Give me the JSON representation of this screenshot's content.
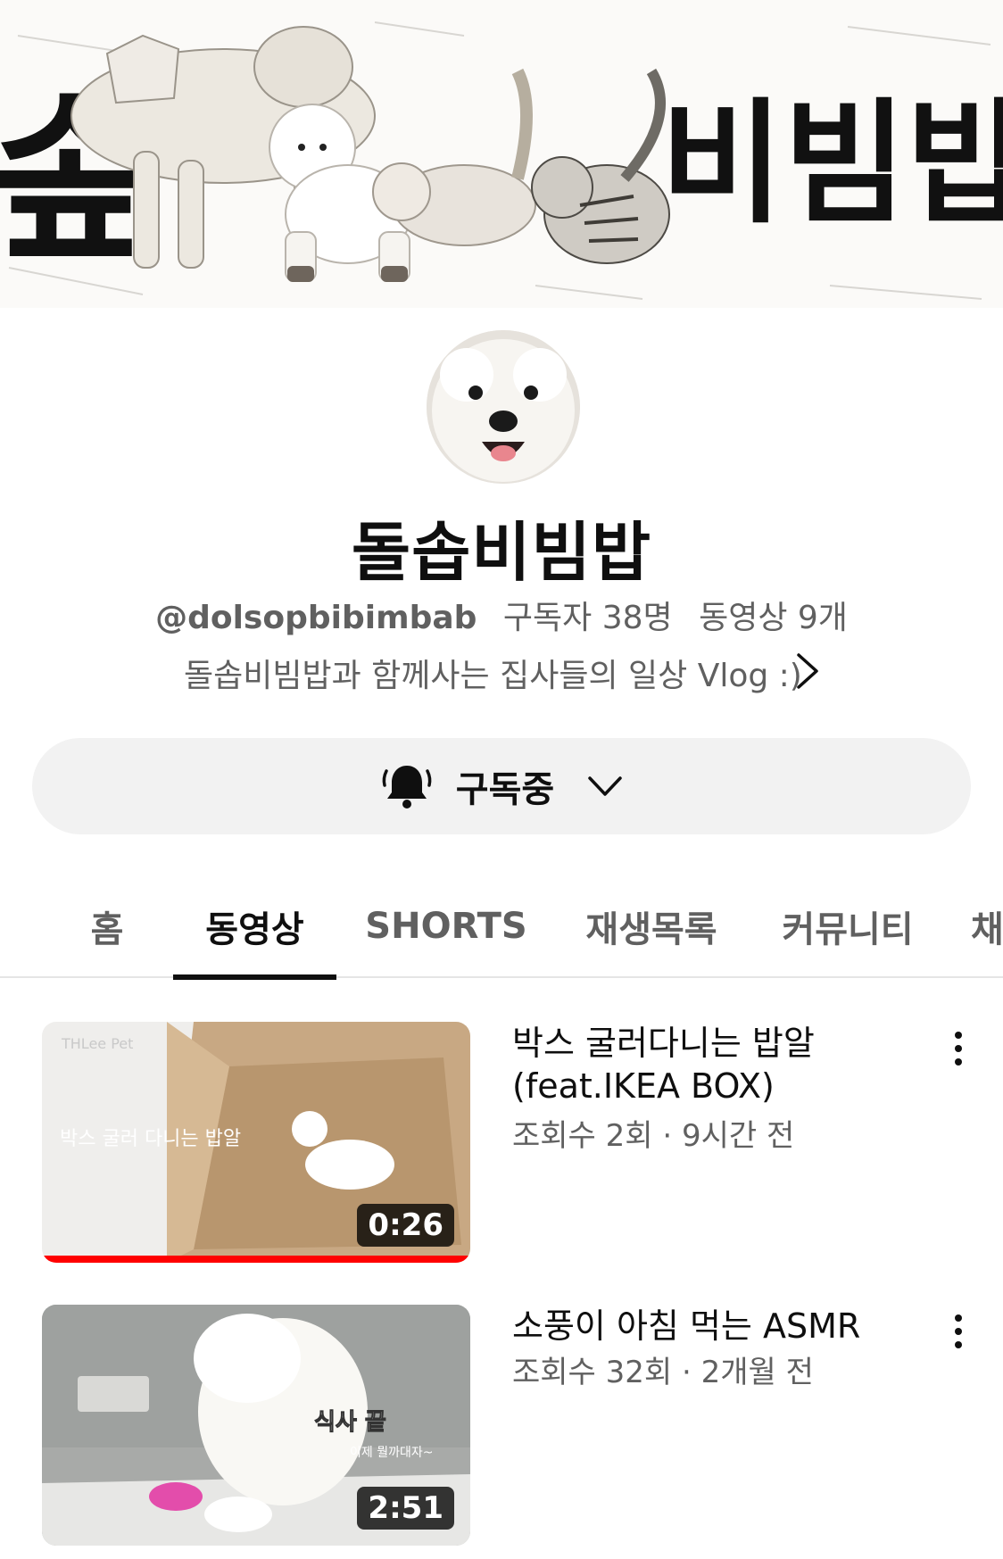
{
  "banner": {
    "title_text": "돌솝비빔밥",
    "visible_left": "솦",
    "visible_right": "비빔밥"
  },
  "channel": {
    "name": "돌솝비빔밥",
    "handle": "@dolsopbibimbab",
    "subscribers": "구독자 38명",
    "video_count": "동영상 9개",
    "description": "돌솝비빔밥과 함께사는 집사들의 일상 Vlog :)"
  },
  "subscribe": {
    "label": "구독중",
    "icon": "bell-icon"
  },
  "tabs": [
    {
      "label": "홈",
      "active": false
    },
    {
      "label": "동영상",
      "active": true
    },
    {
      "label": "SHORTS",
      "active": false
    },
    {
      "label": "재생목록",
      "active": false
    },
    {
      "label": "커뮤니티",
      "active": false
    },
    {
      "label": "채",
      "active": false
    }
  ],
  "videos": [
    {
      "title_line1": "박스 굴러다니는 밥알",
      "title_line2": "(feat.IKEA BOX)",
      "meta": "조회수 2회 · 9시간 전",
      "duration": "0:26",
      "watch_progress": 1.0,
      "thumb_text": "박스 굴러 다니는 밥알",
      "thumb_watermark": "THLee Pet"
    },
    {
      "title_line1": "소풍이 아침 먹는 ASMR",
      "meta": "조회수 32회 · 2개월 전",
      "duration": "2:51",
      "thumb_text": "식사 끝",
      "thumb_subtext": "이제 뭘까대자~"
    }
  ],
  "colors": {
    "accent": "#ff0000",
    "text_primary": "#0f0f0f",
    "text_secondary": "#606060",
    "button_bg": "#f2f2f2"
  }
}
